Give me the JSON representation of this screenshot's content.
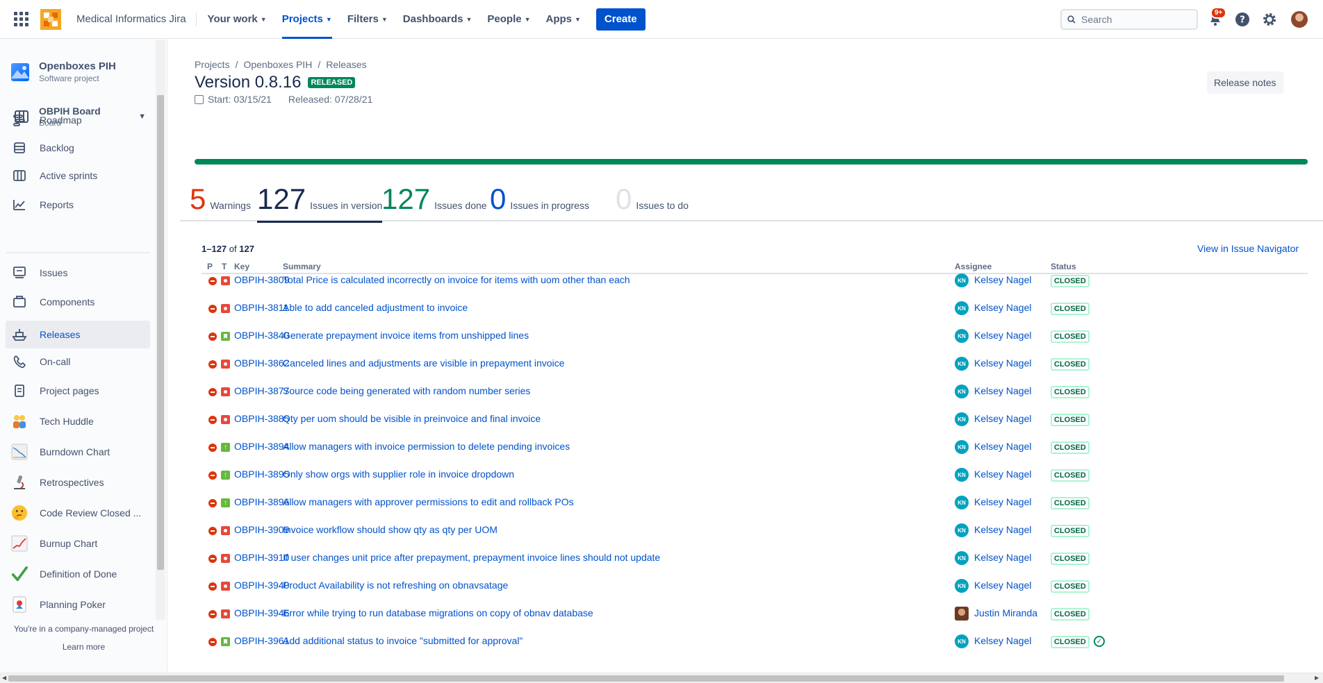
{
  "topnav": {
    "site_name": "Medical Informatics Jira",
    "items": [
      {
        "label": "Your work",
        "active": false
      },
      {
        "label": "Projects",
        "active": true
      },
      {
        "label": "Filters",
        "active": false
      },
      {
        "label": "Dashboards",
        "active": false
      },
      {
        "label": "People",
        "active": false
      },
      {
        "label": "Apps",
        "active": false
      }
    ],
    "create_label": "Create",
    "search_placeholder": "Search",
    "notification_badge": "9+",
    "icons": [
      "app-switcher-icon",
      "notification-icon",
      "help-icon",
      "settings-icon"
    ]
  },
  "sidebar": {
    "project_name": "Openboxes PIH",
    "project_type": "Software project",
    "board_name": "OBPIH Board",
    "board_type": "Board",
    "items": [
      {
        "label": "Roadmap",
        "icon": "roadmap-icon"
      },
      {
        "label": "Backlog",
        "icon": "backlog-icon"
      },
      {
        "label": "Active sprints",
        "icon": "board-icon"
      },
      {
        "label": "Reports",
        "icon": "reports-icon"
      },
      {
        "label": "Issues",
        "icon": "issues-icon"
      },
      {
        "label": "Components",
        "icon": "components-icon"
      },
      {
        "label": "Releases",
        "icon": "ship-icon",
        "active": true
      },
      {
        "label": "On-call",
        "icon": "phone-icon"
      },
      {
        "label": "Project pages",
        "icon": "page-icon"
      },
      {
        "label": "Tech Huddle",
        "icon": "people-emoji-icon"
      },
      {
        "label": "Burndown Chart",
        "icon": "burndown-chart-icon"
      },
      {
        "label": "Retrospectives",
        "icon": "microscope-icon"
      },
      {
        "label": "Code Review Closed ...",
        "icon": "thinking-face-icon"
      },
      {
        "label": "Burnup Chart",
        "icon": "chart-increasing-icon"
      },
      {
        "label": "Definition of Done",
        "icon": "check-mark-icon"
      },
      {
        "label": "Planning Poker",
        "icon": "joker-card-icon"
      }
    ],
    "footer_text": "You're in a company-managed project",
    "learn_more": "Learn more"
  },
  "main": {
    "breadcrumb": [
      "Projects",
      "Openboxes PIH",
      "Releases"
    ],
    "title": "Version 0.8.16",
    "status_badge": "RELEASED",
    "start": "Start: 03/15/21",
    "released": "Released: 07/28/21",
    "release_notes": "Release notes",
    "progress_percent_done": 100,
    "stats": [
      {
        "num": "5",
        "label": "Warnings",
        "color": "#de350b"
      },
      {
        "num": "127",
        "label": "Issues in version",
        "color": "#172b4d",
        "active": true
      },
      {
        "num": "127",
        "label": "Issues done",
        "color": "#00875a"
      },
      {
        "num": "0",
        "label": "Issues in progress",
        "color": "#0052cc"
      },
      {
        "num": "0",
        "label": "Issues to do",
        "color": "#dfe1e6"
      }
    ],
    "count_range": "1–127",
    "count_of": "of",
    "count_total": "127",
    "view_nav": "View in Issue Navigator",
    "columns": {
      "p": "P",
      "t": "T",
      "key": "Key",
      "summary": "Summary",
      "assignee": "Assignee",
      "status": "Status"
    },
    "rows": [
      {
        "type": "bug",
        "key": "OBPIH-3809",
        "summary": "Total Price is calculated incorrectly on invoice for items with uom other than each",
        "assignee": "Kelsey Nagel",
        "initials": "KN",
        "status": "CLOSED"
      },
      {
        "type": "bug",
        "key": "OBPIH-3811",
        "summary": "Able to add canceled adjustment to invoice",
        "assignee": "Kelsey Nagel",
        "initials": "KN",
        "status": "CLOSED"
      },
      {
        "type": "story",
        "key": "OBPIH-3840",
        "summary": "Generate prepayment invoice items from unshipped lines",
        "assignee": "Kelsey Nagel",
        "initials": "KN",
        "status": "CLOSED"
      },
      {
        "type": "bug",
        "key": "OBPIH-3862",
        "summary": "Canceled lines and adjustments are visible in prepayment invoice",
        "assignee": "Kelsey Nagel",
        "initials": "KN",
        "status": "CLOSED"
      },
      {
        "type": "bug",
        "key": "OBPIH-3877",
        "summary": "Source code being generated with random number series",
        "assignee": "Kelsey Nagel",
        "initials": "KN",
        "status": "CLOSED"
      },
      {
        "type": "bug",
        "key": "OBPIH-3885",
        "summary": "Qty per uom should be visible in preinvoice and final invoice",
        "assignee": "Kelsey Nagel",
        "initials": "KN",
        "status": "CLOSED"
      },
      {
        "type": "improvement",
        "key": "OBPIH-3894",
        "summary": "Allow managers with invoice permission to delete pending invoices",
        "assignee": "Kelsey Nagel",
        "initials": "KN",
        "status": "CLOSED"
      },
      {
        "type": "improvement",
        "key": "OBPIH-3895",
        "summary": "Only show orgs with supplier role in invoice dropdown",
        "assignee": "Kelsey Nagel",
        "initials": "KN",
        "status": "CLOSED"
      },
      {
        "type": "improvement",
        "key": "OBPIH-3896",
        "summary": "Allow managers with approver permissions to edit and rollback POs",
        "assignee": "Kelsey Nagel",
        "initials": "KN",
        "status": "CLOSED"
      },
      {
        "type": "bug",
        "key": "OBPIH-3909",
        "summary": "Invoice workflow should show qty as qty per UOM",
        "assignee": "Kelsey Nagel",
        "initials": "KN",
        "status": "CLOSED"
      },
      {
        "type": "bug",
        "key": "OBPIH-3910",
        "summary": "If user changes unit price after prepayment, prepayment invoice lines should not update",
        "assignee": "Kelsey Nagel",
        "initials": "KN",
        "status": "CLOSED"
      },
      {
        "type": "bug",
        "key": "OBPIH-3940",
        "summary": "Product Availability is not refreshing on obnavsatage",
        "assignee": "Kelsey Nagel",
        "initials": "KN",
        "status": "CLOSED"
      },
      {
        "type": "bug",
        "key": "OBPIH-3946",
        "summary": "Error while trying to run database migrations on copy of obnav database",
        "assignee": "Justin Miranda",
        "initials": "",
        "photo": true,
        "status": "CLOSED"
      },
      {
        "type": "story",
        "key": "OBPIH-3961",
        "summary": "Add additional status to invoice \"submitted for approval\"",
        "assignee": "Kelsey Nagel",
        "initials": "KN",
        "status": "CLOSED",
        "check": true
      }
    ]
  }
}
